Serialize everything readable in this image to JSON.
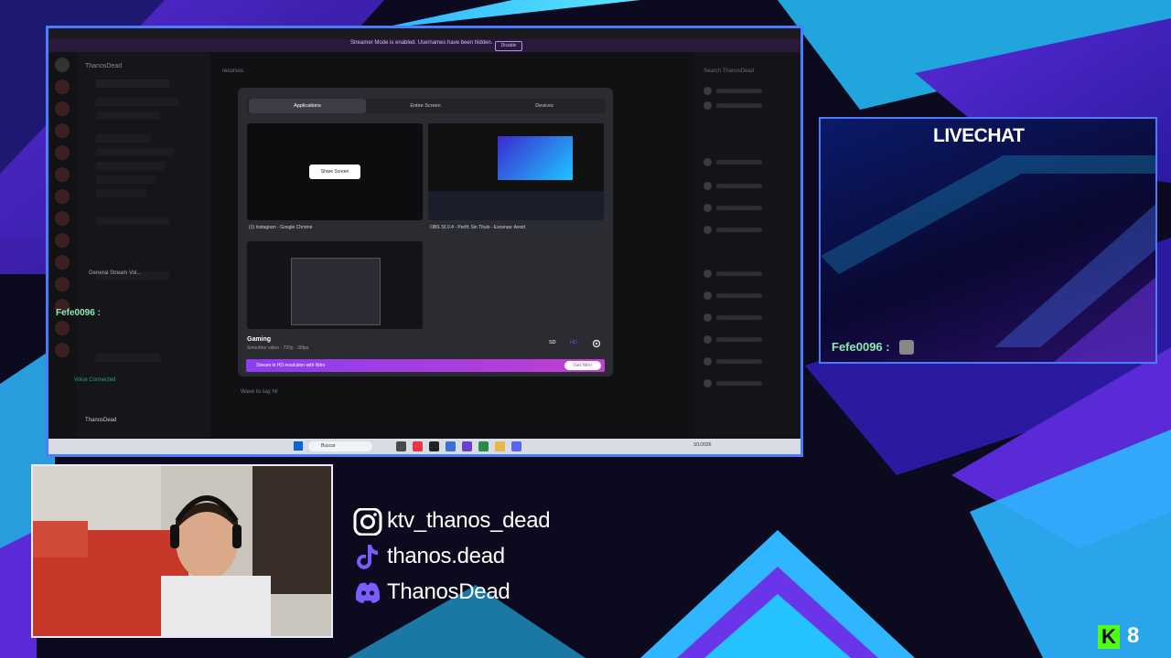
{
  "screen_share": {
    "banner_text": "Streamer Mode is enabled. Usernames have been hidden.",
    "banner_button": "Disable",
    "server_name": "ThanosDead",
    "channel_search": "recursos",
    "member_search": "Search ThanosDead",
    "chat_placeholder": "Wave to say hi!",
    "user_name": "ThanosDead",
    "voice_status": "Voice Connected",
    "voice_channel": "General Stream Vol..."
  },
  "overlay_chat": {
    "name": "Fefe0096 :"
  },
  "dialog": {
    "tabs": [
      "Applications",
      "Entire Screen",
      "Devices"
    ],
    "active_tab": "Applications",
    "thumb_inner_button": "Share Screen",
    "thumb1_caption": "(1) Instagram - Google Chrome",
    "thumb2_caption": "OBS 32.0.4 - Perfil: Sin Título - Escenas: Avoid",
    "mode_label": "Gaming",
    "mode_sub": "Smoother video · 720p · 30fps",
    "quality_sd": "SD",
    "quality_hd": "HD",
    "nitro_text": "Stream in HD resolution with Nitro",
    "nitro_button": "Get Nitro"
  },
  "taskbar": {
    "search_label": "Buscar",
    "clock": "3/1/2026"
  },
  "livechat": {
    "title": "LIVECHAT",
    "chat_name": "Fefe0096 :"
  },
  "socials": [
    {
      "icon": "instagram-icon",
      "handle": "ktv_thanos_dead"
    },
    {
      "icon": "tiktok-icon",
      "handle": "thanos.dead"
    },
    {
      "icon": "discord-icon",
      "handle": "ThanosDead"
    }
  ],
  "badge": {
    "letter": "K",
    "count": "8"
  },
  "colors": {
    "accent_blue": "#4b7bff",
    "accent_purple": "#7a3cff",
    "chat_green": "#8be9b3",
    "nitro_pink": "#c23fd1"
  }
}
